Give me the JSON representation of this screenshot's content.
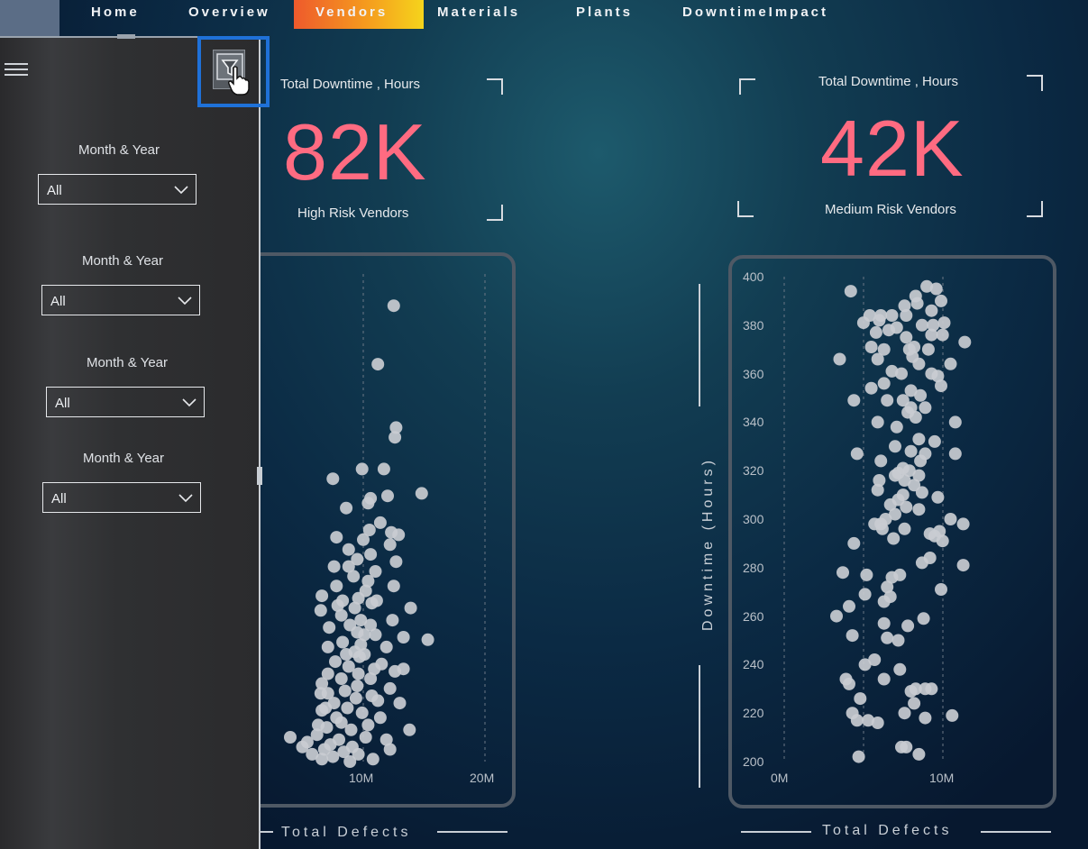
{
  "nav": {
    "tabs": [
      {
        "label": "Home"
      },
      {
        "label": "Overview"
      },
      {
        "label": "Vendors",
        "active": true
      },
      {
        "label": "Materials"
      },
      {
        "label": "Plants"
      },
      {
        "label": "DowntimeImpact"
      }
    ]
  },
  "filter_pane": {
    "slicers": [
      {
        "label": "Month & Year",
        "value": "All"
      },
      {
        "label": "Month & Year",
        "value": "All"
      },
      {
        "label": "Month & Year",
        "value": "All"
      },
      {
        "label": "Month & Year",
        "value": "All"
      }
    ],
    "icons": [
      "hamburger-menu-icon",
      "filter-icon",
      "hand-cursor-icon"
    ]
  },
  "kpis": [
    {
      "title": "Total Downtime , Hours",
      "value": "82K",
      "subtitle": "High Risk Vendors"
    },
    {
      "title": "Total Downtime , Hours",
      "value": "42K",
      "subtitle": "Medium Risk Vendors"
    }
  ],
  "colors": {
    "accent": "#ff6b81",
    "highlight": "#1f71d8",
    "active_tab_start": "#ee5a2c",
    "active_tab_end": "#f5d41c"
  },
  "chart_data": [
    {
      "type": "scatter",
      "xlabel": "Total Defects",
      "ylabel": "",
      "x_ticks": [
        "10M",
        "20M"
      ],
      "xlim": [
        0,
        20000000
      ],
      "ylim": [
        200,
        400
      ],
      "points": [
        [
          12500000,
          387
        ],
        [
          11200000,
          363
        ],
        [
          12700000,
          337
        ],
        [
          12600000,
          333
        ],
        [
          11700000,
          320
        ],
        [
          9900000,
          320
        ],
        [
          7500000,
          316
        ],
        [
          14800000,
          310
        ],
        [
          10600000,
          308
        ],
        [
          12000000,
          309
        ],
        [
          10400000,
          306
        ],
        [
          8600000,
          304
        ],
        [
          11400000,
          298
        ],
        [
          10500000,
          295
        ],
        [
          12300000,
          294
        ],
        [
          12900000,
          293
        ],
        [
          7800000,
          292
        ],
        [
          10000000,
          291
        ],
        [
          12200000,
          289
        ],
        [
          8800000,
          287
        ],
        [
          10600000,
          285
        ],
        [
          9500000,
          283
        ],
        [
          12700000,
          282
        ],
        [
          7600000,
          280
        ],
        [
          8800000,
          280
        ],
        [
          11000000,
          278
        ],
        [
          9200000,
          276
        ],
        [
          10400000,
          274
        ],
        [
          7800000,
          272
        ],
        [
          12500000,
          272
        ],
        [
          10200000,
          270
        ],
        [
          6600000,
          268
        ],
        [
          9600000,
          267
        ],
        [
          8300000,
          266
        ],
        [
          11100000,
          266
        ],
        [
          10700000,
          265
        ],
        [
          7900000,
          264
        ],
        [
          9300000,
          263
        ],
        [
          13900000,
          263
        ],
        [
          6500000,
          262
        ],
        [
          8200000,
          260
        ],
        [
          9800000,
          258
        ],
        [
          10600000,
          256
        ],
        [
          8900000,
          256
        ],
        [
          12400000,
          258
        ],
        [
          7200000,
          255
        ],
        [
          9500000,
          253
        ],
        [
          10100000,
          252
        ],
        [
          11000000,
          252
        ],
        [
          15300000,
          250
        ],
        [
          13300000,
          251
        ],
        [
          8300000,
          249
        ],
        [
          9800000,
          248
        ],
        [
          7100000,
          247
        ],
        [
          11900000,
          247
        ],
        [
          9300000,
          245
        ],
        [
          8600000,
          244
        ],
        [
          10100000,
          244
        ],
        [
          9700000,
          243
        ],
        [
          7700000,
          241
        ],
        [
          11500000,
          240
        ],
        [
          8800000,
          239
        ],
        [
          10900000,
          238
        ],
        [
          13300000,
          238
        ],
        [
          12600000,
          237
        ],
        [
          9600000,
          236
        ],
        [
          7100000,
          236
        ],
        [
          8200000,
          234
        ],
        [
          10600000,
          234
        ],
        [
          6600000,
          232
        ],
        [
          9500000,
          231
        ],
        [
          12200000,
          230
        ],
        [
          8500000,
          229
        ],
        [
          7100000,
          228
        ],
        [
          6500000,
          228
        ],
        [
          10700000,
          227
        ],
        [
          9400000,
          226
        ],
        [
          11200000,
          225
        ],
        [
          7600000,
          224
        ],
        [
          13000000,
          224
        ],
        [
          8700000,
          222
        ],
        [
          6600000,
          221
        ],
        [
          9900000,
          220
        ],
        [
          7800000,
          218
        ],
        [
          11400000,
          218
        ],
        [
          8200000,
          216
        ],
        [
          10400000,
          215
        ],
        [
          7000000,
          214
        ],
        [
          9000000,
          213
        ],
        [
          13800000,
          213
        ],
        [
          6200000,
          211
        ],
        [
          10200000,
          210
        ],
        [
          8000000,
          209
        ],
        [
          11900000,
          209
        ],
        [
          5400000,
          208
        ],
        [
          7300000,
          207
        ],
        [
          9100000,
          206
        ],
        [
          6800000,
          205
        ],
        [
          12200000,
          205
        ],
        [
          8400000,
          204
        ],
        [
          5800000,
          203
        ],
        [
          9600000,
          203
        ],
        [
          7500000,
          202
        ],
        [
          10800000,
          201
        ],
        [
          6600000,
          201
        ],
        [
          8900000,
          200
        ],
        [
          4000000,
          210
        ],
        [
          5000000,
          206
        ],
        [
          6300000,
          215
        ],
        [
          6900000,
          222
        ]
      ]
    },
    {
      "type": "scatter",
      "xlabel": "Total Defects",
      "ylabel": "Downtime (Hours)",
      "y_ticks": [
        "400",
        "380",
        "360",
        "340",
        "320",
        "300",
        "280",
        "260",
        "240",
        "220",
        "200"
      ],
      "x_ticks": [
        "0M",
        "10M"
      ],
      "xlim": [
        0,
        14000000
      ],
      "ylim": [
        200,
        400
      ],
      "points": [
        [
          4200000,
          394
        ],
        [
          9000000,
          396
        ],
        [
          9600000,
          395
        ],
        [
          8300000,
          392
        ],
        [
          9900000,
          390
        ],
        [
          8400000,
          389
        ],
        [
          7600000,
          388
        ],
        [
          9300000,
          386
        ],
        [
          5400000,
          384
        ],
        [
          6100000,
          384
        ],
        [
          6800000,
          384
        ],
        [
          7700000,
          384
        ],
        [
          6000000,
          382
        ],
        [
          5000000,
          381
        ],
        [
          10100000,
          381
        ],
        [
          8700000,
          380
        ],
        [
          9400000,
          380
        ],
        [
          7100000,
          379
        ],
        [
          6600000,
          378
        ],
        [
          5800000,
          377
        ],
        [
          9300000,
          376
        ],
        [
          10000000,
          376
        ],
        [
          7700000,
          375
        ],
        [
          11400000,
          373
        ],
        [
          5500000,
          371
        ],
        [
          8200000,
          371
        ],
        [
          7900000,
          370
        ],
        [
          9100000,
          370
        ],
        [
          6300000,
          370
        ],
        [
          8100000,
          367
        ],
        [
          5900000,
          366
        ],
        [
          3500000,
          366
        ],
        [
          8500000,
          364
        ],
        [
          10500000,
          364
        ],
        [
          6800000,
          361
        ],
        [
          9300000,
          360
        ],
        [
          7400000,
          360
        ],
        [
          9700000,
          359
        ],
        [
          6300000,
          356
        ],
        [
          9900000,
          355
        ],
        [
          5500000,
          354
        ],
        [
          8000000,
          353
        ],
        [
          8600000,
          351
        ],
        [
          4400000,
          349
        ],
        [
          6500000,
          349
        ],
        [
          7500000,
          349
        ],
        [
          8000000,
          346
        ],
        [
          8900000,
          346
        ],
        [
          7800000,
          344
        ],
        [
          8300000,
          342
        ],
        [
          5900000,
          340
        ],
        [
          10800000,
          340
        ],
        [
          7100000,
          338
        ],
        [
          8500000,
          333
        ],
        [
          9500000,
          332
        ],
        [
          7000000,
          330
        ],
        [
          8000000,
          328
        ],
        [
          4600000,
          327
        ],
        [
          8900000,
          327
        ],
        [
          10800000,
          327
        ],
        [
          6100000,
          324
        ],
        [
          8600000,
          324
        ],
        [
          7500000,
          321
        ],
        [
          7900000,
          320
        ],
        [
          7200000,
          319
        ],
        [
          8500000,
          318
        ],
        [
          7000000,
          318
        ],
        [
          7600000,
          316
        ],
        [
          6000000,
          316
        ],
        [
          8200000,
          314
        ],
        [
          5900000,
          312
        ],
        [
          8700000,
          311
        ],
        [
          7500000,
          310
        ],
        [
          9700000,
          309
        ],
        [
          7200000,
          308
        ],
        [
          6700000,
          306
        ],
        [
          7700000,
          305
        ],
        [
          8500000,
          304
        ],
        [
          7000000,
          302
        ],
        [
          6400000,
          300
        ],
        [
          10500000,
          300
        ],
        [
          6100000,
          298
        ],
        [
          5700000,
          298
        ],
        [
          11300000,
          298
        ],
        [
          6200000,
          296
        ],
        [
          7600000,
          296
        ],
        [
          9800000,
          295
        ],
        [
          9200000,
          294
        ],
        [
          9500000,
          293
        ],
        [
          6900000,
          292
        ],
        [
          10000000,
          291
        ],
        [
          4400000,
          290
        ],
        [
          9200000,
          284
        ],
        [
          8700000,
          282
        ],
        [
          3700000,
          278
        ],
        [
          5200000,
          277
        ],
        [
          7300000,
          277
        ],
        [
          6800000,
          276
        ],
        [
          11300000,
          281
        ],
        [
          6500000,
          272
        ],
        [
          5100000,
          269
        ],
        [
          6700000,
          268
        ],
        [
          9900000,
          271
        ],
        [
          6300000,
          266
        ],
        [
          4100000,
          264
        ],
        [
          3300000,
          260
        ],
        [
          8800000,
          259
        ],
        [
          6300000,
          257
        ],
        [
          7800000,
          256
        ],
        [
          4300000,
          252
        ],
        [
          6500000,
          251
        ],
        [
          7200000,
          250
        ],
        [
          5700000,
          242
        ],
        [
          5100000,
          240
        ],
        [
          7300000,
          238
        ],
        [
          6300000,
          234
        ],
        [
          3900000,
          234
        ],
        [
          4100000,
          232
        ],
        [
          8300000,
          230
        ],
        [
          8900000,
          230
        ],
        [
          8000000,
          229
        ],
        [
          9300000,
          230
        ],
        [
          4800000,
          226
        ],
        [
          8200000,
          224
        ],
        [
          4300000,
          220
        ],
        [
          5300000,
          217
        ],
        [
          4600000,
          217
        ],
        [
          8900000,
          218
        ],
        [
          7600000,
          220
        ],
        [
          10600000,
          219
        ],
        [
          5900000,
          216
        ],
        [
          7400000,
          206
        ],
        [
          7700000,
          206
        ],
        [
          8500000,
          203
        ],
        [
          4700000,
          202
        ]
      ]
    }
  ]
}
